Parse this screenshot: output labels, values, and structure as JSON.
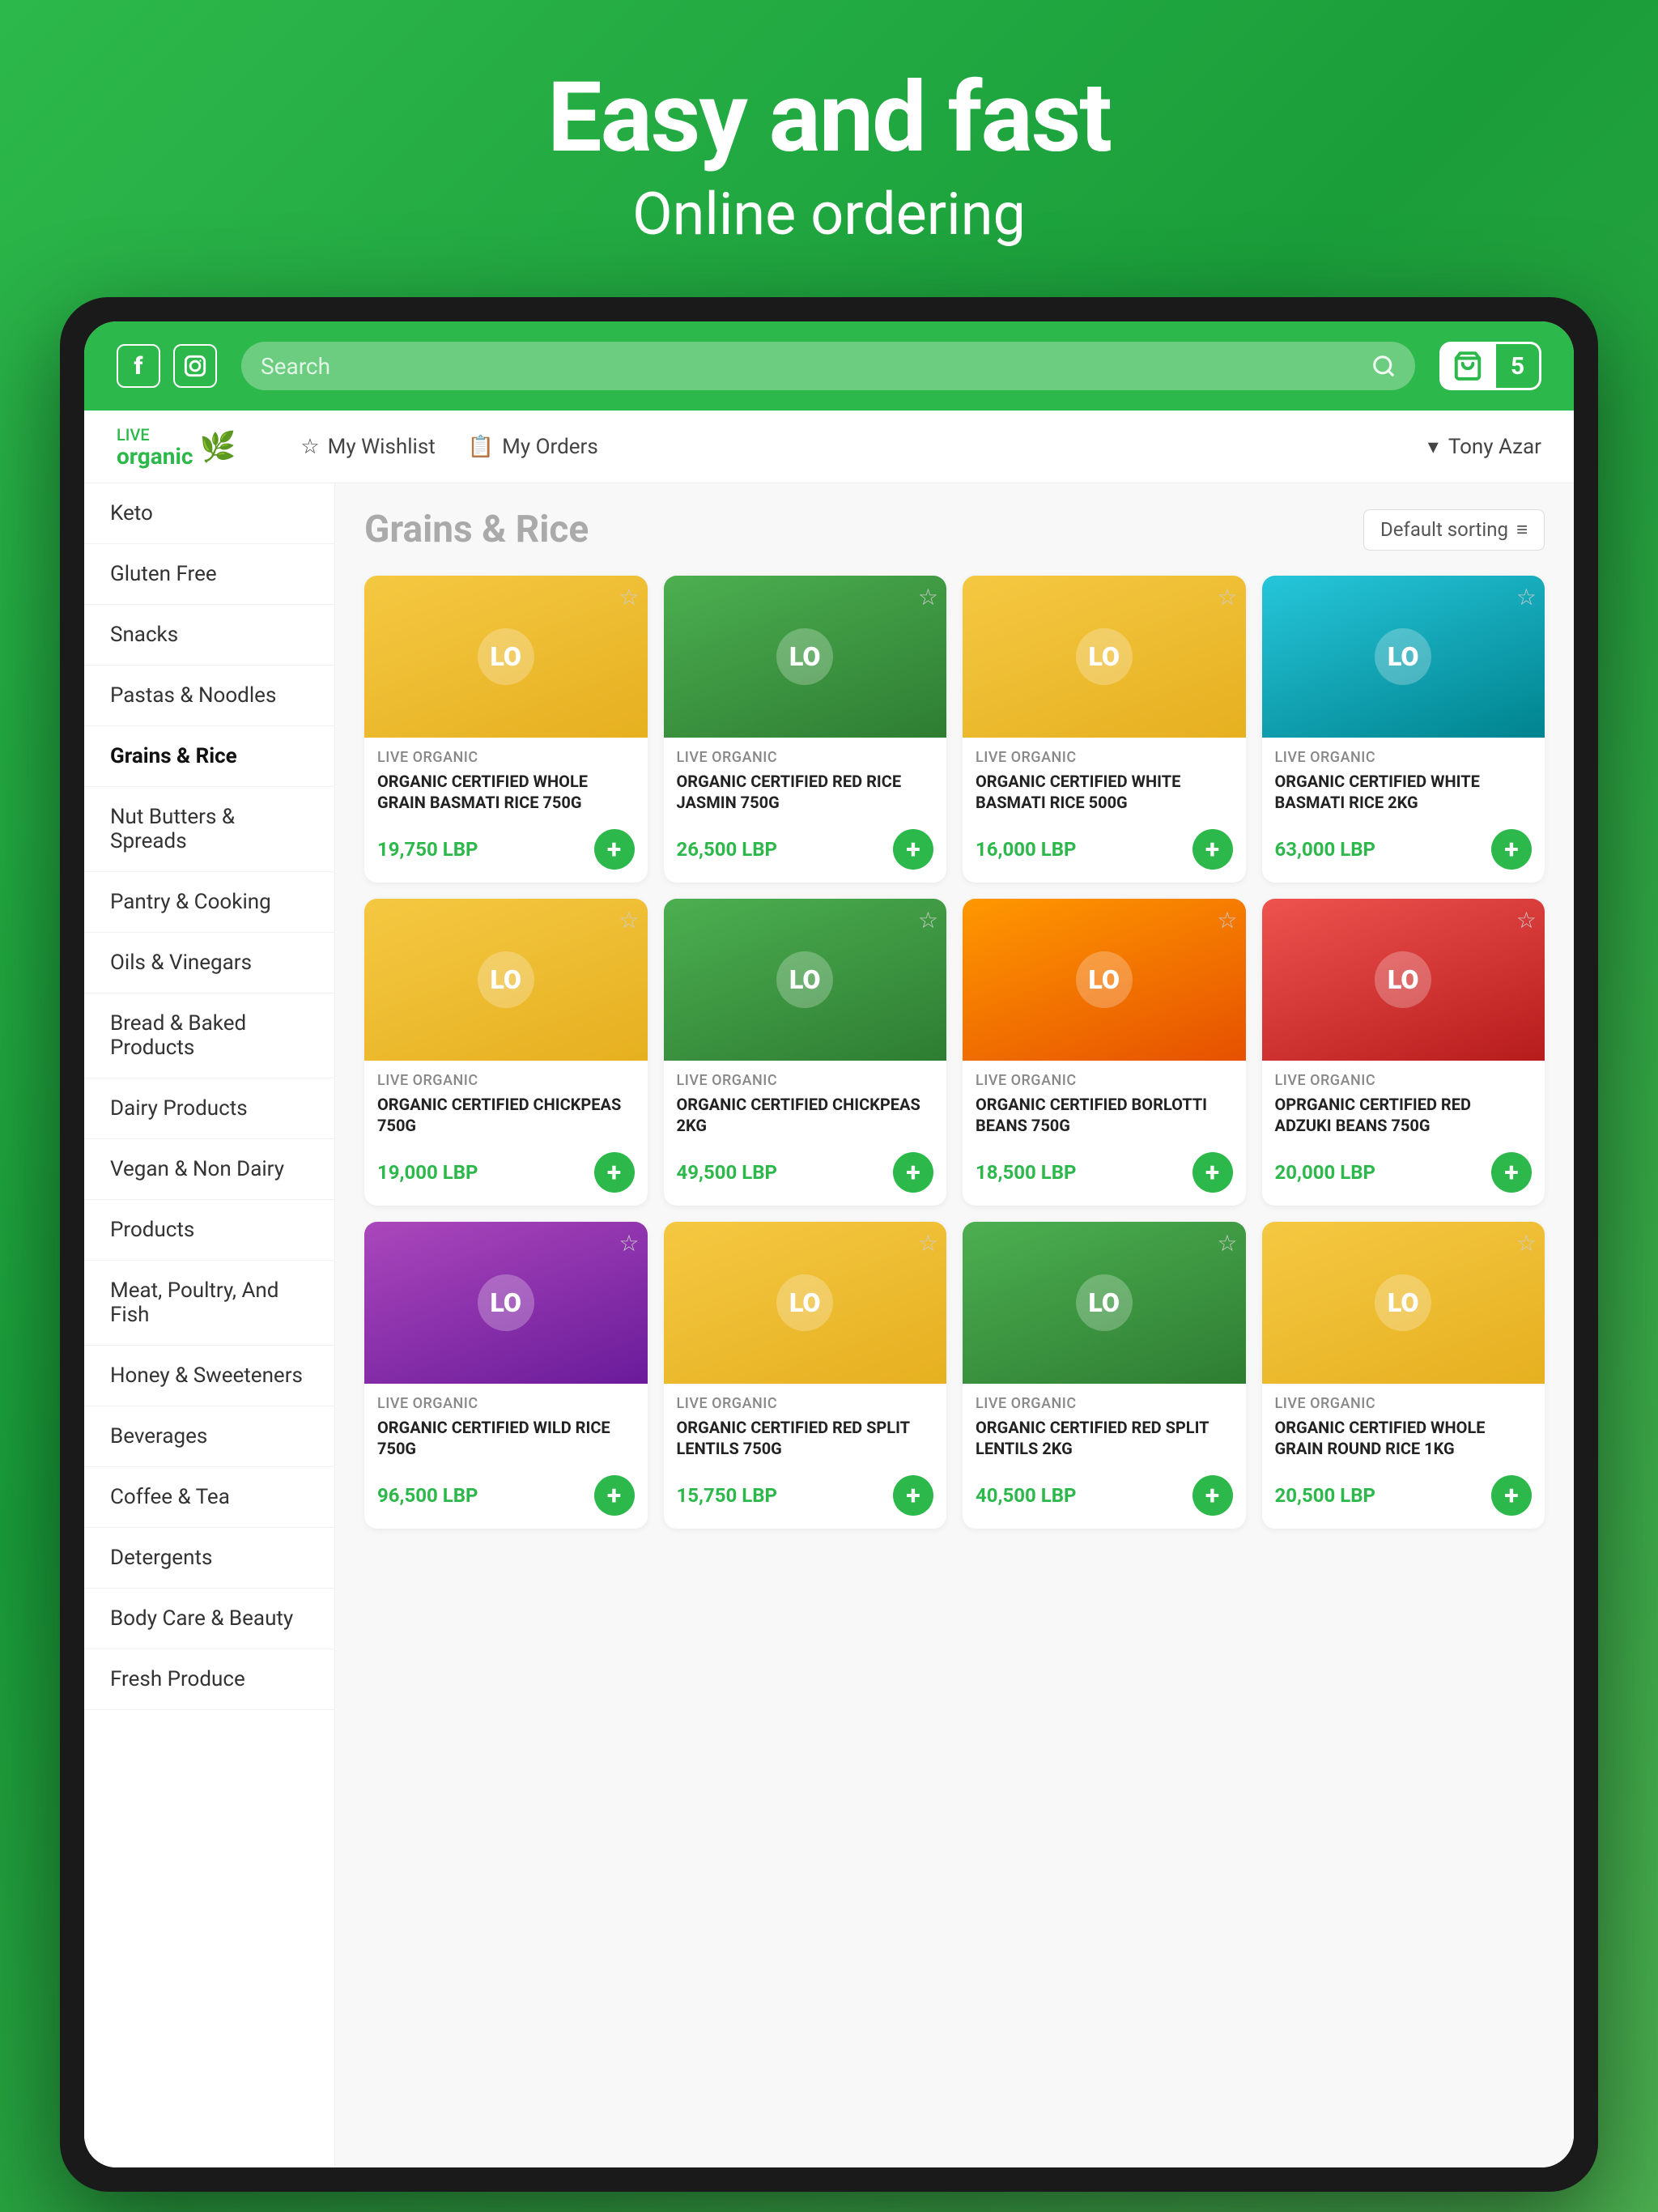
{
  "hero": {
    "title": "Easy and fast",
    "subtitle": "Online ordering"
  },
  "header": {
    "search_placeholder": "Search",
    "cart_count": "5",
    "facebook_icon": "f",
    "instagram_icon": "📷"
  },
  "sub_header": {
    "logo_line1": "LIVE",
    "logo_line2": "organic",
    "wishlist_label": "My Wishlist",
    "orders_label": "My Orders",
    "user_name": "Tony Azar",
    "sort_label": "Default sorting"
  },
  "sidebar": {
    "items": [
      {
        "label": "Keto",
        "active": false
      },
      {
        "label": "Gluten Free",
        "active": false
      },
      {
        "label": "Snacks",
        "active": false
      },
      {
        "label": "Pastas & Noodles",
        "active": false
      },
      {
        "label": "Grains & Rice",
        "active": true
      },
      {
        "label": "Nut Butters & Spreads",
        "active": false
      },
      {
        "label": "Pantry & Cooking",
        "active": false
      },
      {
        "label": "Oils & Vinegars",
        "active": false
      },
      {
        "label": "Bread & Baked Products",
        "active": false
      },
      {
        "label": "Dairy Products",
        "active": false
      },
      {
        "label": "Vegan & Non Dairy",
        "active": false
      },
      {
        "label": "Products",
        "active": false
      },
      {
        "label": "Meat, Poultry, And Fish",
        "active": false
      },
      {
        "label": "Honey & Sweeteners",
        "active": false
      },
      {
        "label": "Beverages",
        "active": false
      },
      {
        "label": "Coffee & Tea",
        "active": false
      },
      {
        "label": "Detergents",
        "active": false
      },
      {
        "label": "Body Care & Beauty",
        "active": false
      },
      {
        "label": "Fresh Produce",
        "active": false
      }
    ]
  },
  "products_section": {
    "title": "Grains & Rice",
    "sort_label": "Default sorting",
    "products": [
      {
        "brand": "LIVE ORGANIC",
        "name": "ORGANIC CERTIFIED WHOLE GRAIN BASMATI RICE 750G",
        "price": "19,750 LBP",
        "bag_color": "bag-yellow"
      },
      {
        "brand": "LIVE ORGANIC",
        "name": "ORGANIC CERTIFIED RED RICE JASMIN 750G",
        "price": "26,500 LBP",
        "bag_color": "bag-green"
      },
      {
        "brand": "LIVE ORGANIC",
        "name": "ORGANIC CERTIFIED WHITE BASMATI RICE 500G",
        "price": "16,000 LBP",
        "bag_color": "bag-yellow"
      },
      {
        "brand": "LIVE ORGANIC",
        "name": "ORGANIC CERTIFIED WHITE BASMATI RICE 2KG",
        "price": "63,000 LBP",
        "bag_color": "bag-teal"
      },
      {
        "brand": "LIVE ORGANIC",
        "name": "ORGANIC CERTIFIED CHICKPEAS 750G",
        "price": "19,000 LBP",
        "bag_color": "bag-yellow"
      },
      {
        "brand": "LIVE ORGANIC",
        "name": "ORGANIC CERTIFIED CHICKPEAS 2KG",
        "price": "49,500 LBP",
        "bag_color": "bag-green"
      },
      {
        "brand": "LIVE ORGANIC",
        "name": "ORGANIC CERTIFIED BORLOTTI BEANS 750G",
        "price": "18,500 LBP",
        "bag_color": "bag-orange"
      },
      {
        "brand": "LIVE ORGANIC",
        "name": "OPRGANIC CERTIFIED RED ADZUKI BEANS 750G",
        "price": "20,000 LBP",
        "bag_color": "bag-red"
      },
      {
        "brand": "LIVE ORGANIC",
        "name": "ORGANIC CERTIFIED WILD RICE 750G",
        "price": "96,500 LBP",
        "bag_color": "bag-purple"
      },
      {
        "brand": "LIVE ORGANIC",
        "name": "ORGANIC CERTIFIED RED SPLIT LENTILS 750G",
        "price": "15,750 LBP",
        "bag_color": "bag-yellow"
      },
      {
        "brand": "LIVE ORGANIC",
        "name": "ORGANIC CERTIFIED RED SPLIT LENTILS 2KG",
        "price": "40,500 LBP",
        "bag_color": "bag-green"
      },
      {
        "brand": "LIVE ORGANIC",
        "name": "ORGANIC CERTIFIED WHOLE GRAIN ROUND RICE 1KG",
        "price": "20,500 LBP",
        "bag_color": "bag-yellow"
      }
    ]
  }
}
